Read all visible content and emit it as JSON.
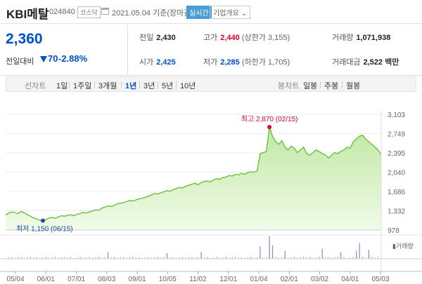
{
  "header": {
    "name": "KBI메탈",
    "code": "024840",
    "market": "코스닥",
    "date": "2021.05.04 기준(장마감)",
    "realtime_label": "실시간",
    "overview_label": "기업개요"
  },
  "summary": {
    "price": "2,360",
    "change_label": "전일대비",
    "change_value": "70",
    "change_rate": "-2.88%",
    "prev_close_label": "전일",
    "prev_close": "2,430",
    "open_label": "시가",
    "open": "2,425",
    "high_label": "고가",
    "high": "2,440",
    "upper_limit": "(상한가 3,155)",
    "low_label": "저가",
    "low": "2,285",
    "lower_limit": "(하한가 1,705)",
    "volume_label": "거래량",
    "volume": "1,071,938",
    "amount_label": "거래대금",
    "amount": "2,522",
    "amount_unit": "백만"
  },
  "period_bar": {
    "line_label": "선차트",
    "periods": [
      "1일",
      "1주일",
      "3개월",
      "1년",
      "3년",
      "5년",
      "10년"
    ],
    "active": "1년",
    "candle_label": "봉차트",
    "candles": [
      "일봉",
      "주봉",
      "월봉"
    ]
  },
  "chart_data": {
    "type": "area",
    "y_ticks": [
      "3,103",
      "2,749",
      "2,395",
      "2,040",
      "1,686",
      "1,332",
      "978"
    ],
    "ylim": [
      978,
      3103
    ],
    "x_ticks": [
      "05/04",
      "06/01",
      "07/01",
      "08/03",
      "09/01",
      "10/05",
      "11/02",
      "12/01",
      "01/04",
      "02/01",
      "03/02",
      "04/01",
      "05/03"
    ],
    "values": [
      1250,
      1290,
      1310,
      1300,
      1280,
      1320,
      1290,
      1260,
      1230,
      1200,
      1180,
      1160,
      1150,
      1170,
      1200,
      1210,
      1190,
      1220,
      1240,
      1230,
      1250,
      1260,
      1240,
      1270,
      1280,
      1300,
      1290,
      1310,
      1330,
      1350,
      1340,
      1380,
      1400,
      1420,
      1410,
      1430,
      1460,
      1470,
      1480,
      1500,
      1520,
      1510,
      1530,
      1550,
      1560,
      1580,
      1600,
      1620,
      1650,
      1640,
      1660,
      1680,
      1700,
      1690,
      1720,
      1740,
      1760,
      1750,
      1780,
      1800,
      1820,
      1840,
      1810,
      1850,
      1870,
      1880,
      1860,
      1900,
      1920,
      1910,
      1940,
      1950,
      1980,
      1970,
      2000,
      1990,
      2020,
      2000,
      2030,
      2050,
      2040,
      2060,
      2380,
      2400,
      2420,
      2870,
      2700,
      2600,
      2550,
      2620,
      2500,
      2450,
      2520,
      2480,
      2400,
      2450,
      2500,
      2380,
      2350,
      2400,
      2450,
      2420,
      2380,
      2360,
      2300,
      2350,
      2400,
      2380,
      2420,
      2450,
      2500,
      2480,
      2600,
      2650,
      2700,
      2720,
      2650,
      2600,
      2550,
      2500,
      2450,
      2360
    ],
    "high_annotation": "최고 2,870 (02/15)",
    "low_annotation": "최저 1,150 (06/15)",
    "high_index": 85,
    "low_index": 12,
    "volume_label": "거래량",
    "volume_spikes": [
      {
        "i": 33,
        "v": 0.3
      },
      {
        "i": 52,
        "v": 0.25
      },
      {
        "i": 63,
        "v": 0.3
      },
      {
        "i": 82,
        "v": 0.55
      },
      {
        "i": 85,
        "v": 1.0
      },
      {
        "i": 86,
        "v": 0.6
      },
      {
        "i": 90,
        "v": 0.35
      },
      {
        "i": 102,
        "v": 0.45
      },
      {
        "i": 108,
        "v": 0.3
      },
      {
        "i": 113,
        "v": 0.35
      },
      {
        "i": 114,
        "v": 0.7
      },
      {
        "i": 117,
        "v": 0.4
      }
    ],
    "colors": {
      "line": "#6ac13a",
      "fill_top": "#bfe8a2",
      "fill_bottom": "#f1fbea",
      "high": "#e1002a",
      "low": "#1b4fa0"
    }
  }
}
